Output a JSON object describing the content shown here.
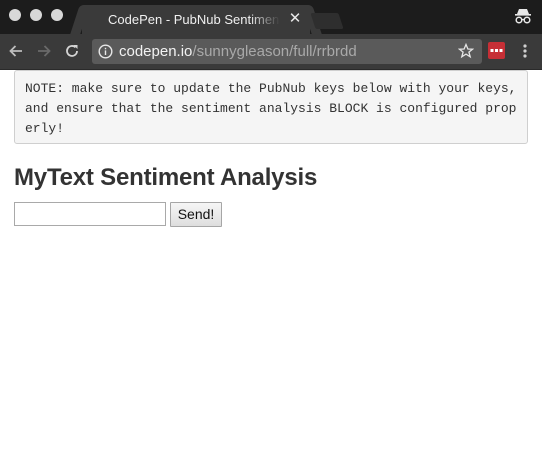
{
  "browser": {
    "tab": {
      "title": "CodePen - PubNub Sentiment Analysis",
      "close_glyph": "✕"
    },
    "address": {
      "host": "codepen.io",
      "path": "/sunnygleason/full/rrbrdd"
    },
    "icons": [
      "back-arrow-icon",
      "forward-arrow-icon",
      "reload-icon",
      "info-icon",
      "bookmark-star-icon",
      "extension-icon",
      "menu-icon",
      "incognito-icon"
    ],
    "colors": {
      "chrome_dark": "#1c1c1c",
      "toolbar": "#3a3a3a",
      "extension": "#c62f36"
    }
  },
  "page": {
    "note_lines": [
      "NOTE: make sure to update the PubNub keys below with your keys,",
      "and ensure that the sentiment analysis BLOCK is configured prop",
      "erly!"
    ],
    "heading": "MyText Sentiment Analysis",
    "input": {
      "value": "",
      "placeholder": ""
    },
    "send_label": "Send!"
  }
}
